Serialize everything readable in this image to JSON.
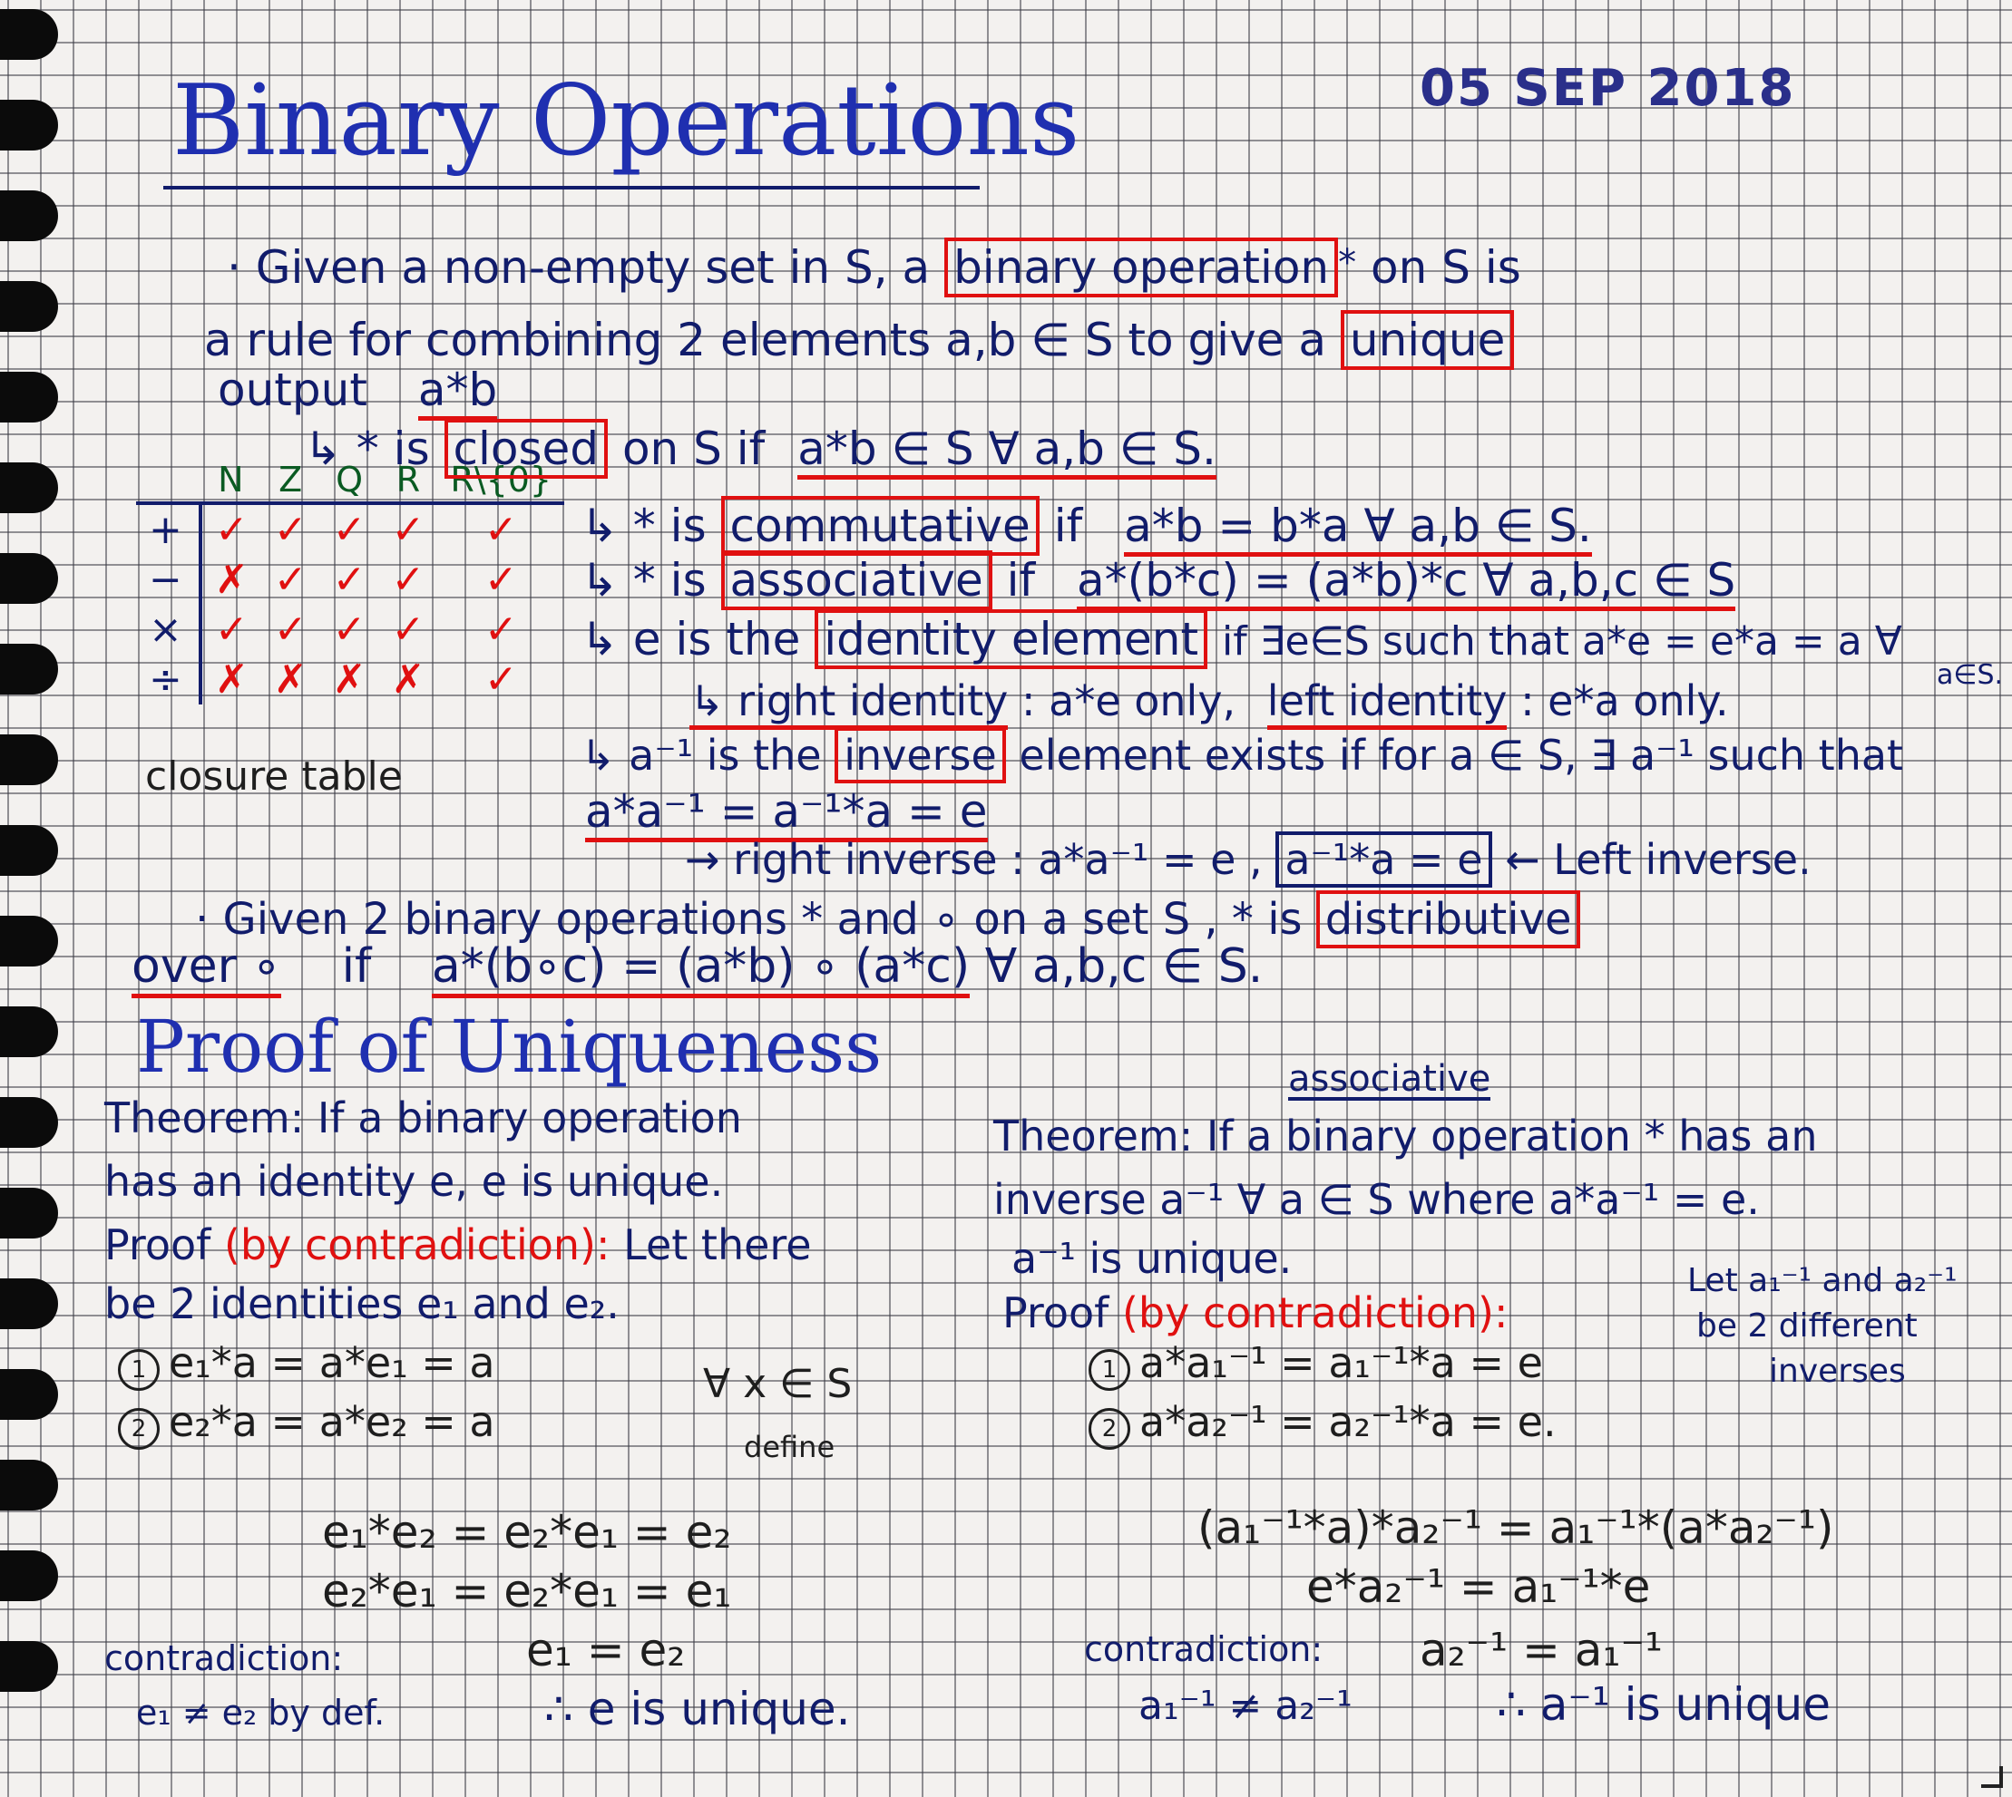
{
  "date_stamp": "05 SEP 2018",
  "title": "Binary Operations",
  "definition": {
    "line1_pre": "· Given a non-empty set in S, a",
    "line1_box": "binary operation",
    "line1_star": "*",
    "line1_post": "on S is",
    "line2_pre": "a rule for combining 2 elements a,b ∈ S to give a",
    "line2_box": "unique",
    "line3_pre": "output",
    "line3_ul": "a*b"
  },
  "properties": {
    "closed_pre": "↳ * is",
    "closed_box": "closed",
    "closed_mid": "on S if",
    "closed_ul": "a*b ∈ S ∀ a,b ∈ S.",
    "comm_pre": "↳ * is",
    "comm_box": "commutative",
    "comm_mid": "if",
    "comm_ul": "a*b = b*a ∀ a,b ∈ S.",
    "assoc_pre": "↳ * is",
    "assoc_box": "associative",
    "assoc_mid": "if",
    "assoc_ul": "a*(b*c) = (a*b)*c ∀ a,b,c ∈ S",
    "ident_pre": "↳ e is the",
    "ident_box": "identity element",
    "ident_post": "if ∃e∈S such that a*e = e*a = a ∀",
    "ident_tail": "a∈S.",
    "right_left_ident_ul1": "↳ right identity",
    "right_left_ident_mid": ": a*e only,",
    "right_left_ident_ul2": "left identity",
    "right_left_ident_post": ": e*a only.",
    "inverse_pre": "↳ a⁻¹ is the",
    "inverse_box": "inverse",
    "inverse_post": "element exists if for a ∈ S, ∃ a⁻¹ such that",
    "inverse_eq": "a*a⁻¹ = a⁻¹*a = e",
    "right_inverse": "→ right inverse : a*a⁻¹ = e ,",
    "left_inverse_box": "a⁻¹*a = e",
    "left_inverse_post": "← Left inverse."
  },
  "distributive": {
    "line1_pre": "· Given 2 binary operations * and ∘ on a set S , * is",
    "line1_box": "distributive",
    "line2_ul": "over ∘",
    "line2_mid": "if",
    "line2_eq": "a*(b∘c) = (a*b) ∘ (a*c)",
    "line2_post": "∀ a,b,c ∈ S."
  },
  "closure_table": {
    "columns": [
      "N",
      "Z",
      "Q",
      "R",
      "R\\{0}"
    ],
    "rows": [
      {
        "op": "+",
        "cells": [
          "✓",
          "✓",
          "✓",
          "✓",
          "✓"
        ]
      },
      {
        "op": "−",
        "cells": [
          "✗",
          "✓",
          "✓",
          "✓",
          "✓"
        ]
      },
      {
        "op": "×",
        "cells": [
          "✓",
          "✓",
          "✓",
          "✓",
          "✓"
        ]
      },
      {
        "op": "÷",
        "cells": [
          "✗",
          "✗",
          "✗",
          "✗",
          "✓"
        ]
      }
    ],
    "caption": "closure table"
  },
  "proof_title": "Proof of Uniqueness",
  "left_proof": {
    "theorem1": "Theorem: If a binary operation",
    "theorem2": "has an identity e, e is unique.",
    "proof_label": "Proof",
    "proof_method": "(by contradiction):",
    "proof_rest": "Let there",
    "line4": "be 2 identities e₁ and e₂.",
    "step1_num": "1",
    "step1": "e₁*a = a*e₁ = a",
    "step2_num": "2",
    "step2": "e₂*a = a*e₂ = a",
    "forall": "∀ x ∈ S",
    "define": "define",
    "eq1": "e₁*e₂ = e₂*e₁ = e₂",
    "eq2": "e₂*e₁ = e₂*e₁ = e₁",
    "contradiction_label": "contradiction:",
    "contradiction_eq": "e₁ = e₂",
    "contradiction_note": "e₁ ≠ e₂ by def.",
    "conclusion": "∴ e is unique."
  },
  "right_proof": {
    "assoc_note": "associative",
    "theorem1": "Theorem: If a binary operation * has an",
    "theorem2": "inverse a⁻¹ ∀ a ∈ S where a*a⁻¹ = e.",
    "theorem3": "a⁻¹ is unique.",
    "proof_label": "Proof",
    "proof_method": "(by contradiction):",
    "side_note1": "Let a₁⁻¹ and a₂⁻¹",
    "side_note2": "be 2 different",
    "side_note3": "inverses",
    "step1_num": "1",
    "step1": "a*a₁⁻¹ = a₁⁻¹*a = e",
    "step2_num": "2",
    "step2": "a*a₂⁻¹ = a₂⁻¹*a = e.",
    "eq1": "(a₁⁻¹*a)*a₂⁻¹ = a₁⁻¹*(a*a₂⁻¹)",
    "eq2": "e*a₂⁻¹ = a₁⁻¹*e",
    "contradiction_label": "contradiction:",
    "contradiction_eq": "a₂⁻¹ = a₁⁻¹",
    "contradiction_note": "a₁⁻¹ ≠ a₂⁻¹",
    "conclusion": "∴ a⁻¹ is unique"
  }
}
